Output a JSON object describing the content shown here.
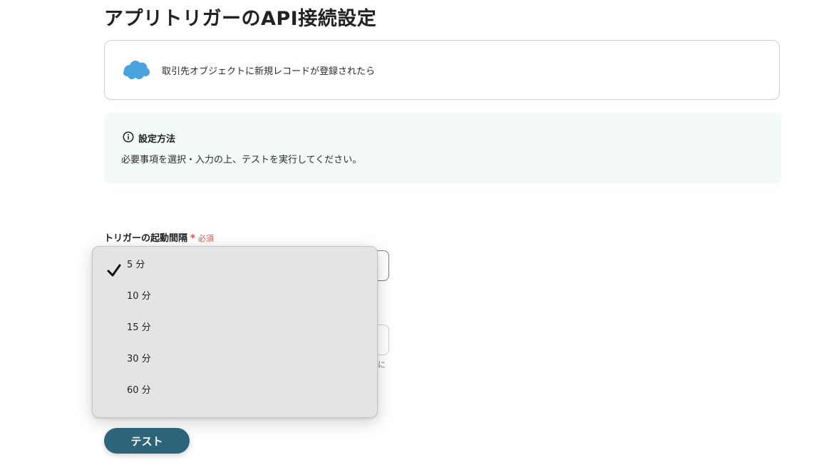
{
  "page": {
    "title": "アプリトリガーのAPI接続設定"
  },
  "trigger": {
    "icon": "salesforce-cloud-icon",
    "label": "取引先オブジェクトに新規レコードが登録されたら",
    "icon_color": "#4aa3df"
  },
  "info": {
    "icon": "info-circle-icon",
    "title": "設定方法",
    "text": "必要事項を選択・入力の上、テストを実行してください。"
  },
  "form": {
    "interval_label": "トリガーの起動間隔",
    "required_star": "*",
    "required_text": "必須",
    "hint_fragment": "に"
  },
  "dropdown": {
    "selected": "5 分",
    "options": [
      {
        "label": "5 分",
        "selected": true
      },
      {
        "label": "10 分",
        "selected": false
      },
      {
        "label": "15 分",
        "selected": false
      },
      {
        "label": "30 分",
        "selected": false
      },
      {
        "label": "60 分",
        "selected": false
      }
    ]
  },
  "actions": {
    "test_label": "テスト",
    "test_color": "#2e6479"
  },
  "colors": {
    "required": "#d9534f",
    "info_bg": "#f4f9fa",
    "dropdown_bg": "#e5e3e4"
  }
}
